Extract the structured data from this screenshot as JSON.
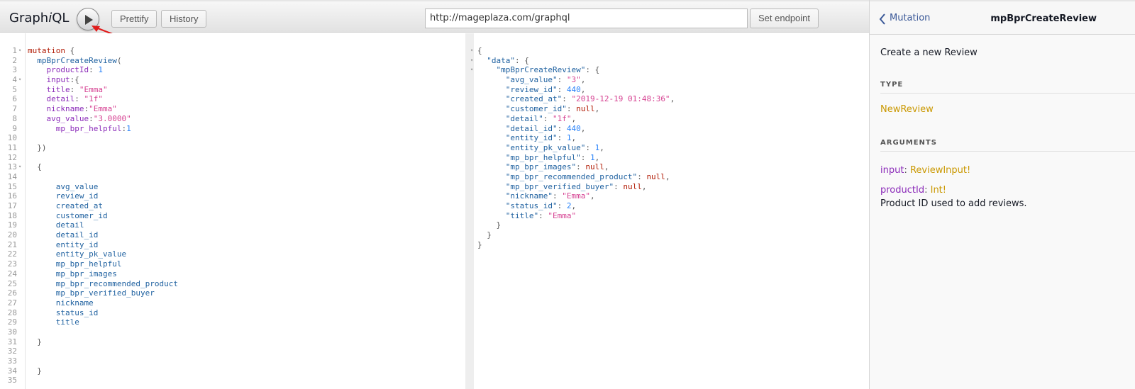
{
  "toolbar": {
    "title_pre": "Graph",
    "title_i": "i",
    "title_post": "QL",
    "prettify_label": "Prettify",
    "history_label": "History",
    "endpoint_url": "http://mageplaza.com/graphql",
    "set_endpoint_label": "Set endpoint"
  },
  "query_lines": [
    {
      "n": "1",
      "fold": true,
      "t": [
        [
          "k",
          "mutation"
        ],
        [
          "p",
          " {"
        ]
      ]
    },
    {
      "n": "2",
      "t": [
        [
          "p",
          "  "
        ],
        [
          "d",
          "mpBprCreateReview"
        ],
        [
          "p",
          "("
        ]
      ]
    },
    {
      "n": "3",
      "t": [
        [
          "p",
          "    "
        ],
        [
          "a",
          "productId"
        ],
        [
          "p",
          ": "
        ],
        [
          "n",
          "1"
        ]
      ]
    },
    {
      "n": "4",
      "fold": true,
      "t": [
        [
          "p",
          "    "
        ],
        [
          "a",
          "input"
        ],
        [
          "p",
          ":{"
        ]
      ]
    },
    {
      "n": "5",
      "t": [
        [
          "p",
          "    "
        ],
        [
          "a",
          "title"
        ],
        [
          "p",
          ": "
        ],
        [
          "s",
          "\"Emma\""
        ]
      ]
    },
    {
      "n": "6",
      "t": [
        [
          "p",
          "    "
        ],
        [
          "a",
          "detail"
        ],
        [
          "p",
          ": "
        ],
        [
          "s",
          "\"1f\""
        ]
      ]
    },
    {
      "n": "7",
      "t": [
        [
          "p",
          "    "
        ],
        [
          "a",
          "nickname"
        ],
        [
          "p",
          ":"
        ],
        [
          "s",
          "\"Emma\""
        ]
      ]
    },
    {
      "n": "8",
      "t": [
        [
          "p",
          "    "
        ],
        [
          "a",
          "avg_value"
        ],
        [
          "p",
          ":"
        ],
        [
          "s",
          "\"3.0000\""
        ]
      ]
    },
    {
      "n": "9",
      "t": [
        [
          "p",
          "      "
        ],
        [
          "a",
          "mp_bpr_helpful"
        ],
        [
          "p",
          ":"
        ],
        [
          "n",
          "1"
        ]
      ]
    },
    {
      "n": "10",
      "t": []
    },
    {
      "n": "11",
      "t": [
        [
          "p",
          "  })"
        ]
      ]
    },
    {
      "n": "12",
      "t": []
    },
    {
      "n": "13",
      "fold": true,
      "t": [
        [
          "p",
          "  {"
        ]
      ]
    },
    {
      "n": "14",
      "t": []
    },
    {
      "n": "15",
      "t": [
        [
          "p",
          "      "
        ],
        [
          "prop",
          "avg_value"
        ]
      ]
    },
    {
      "n": "16",
      "t": [
        [
          "p",
          "      "
        ],
        [
          "prop",
          "review_id"
        ]
      ]
    },
    {
      "n": "17",
      "t": [
        [
          "p",
          "      "
        ],
        [
          "prop",
          "created_at"
        ]
      ]
    },
    {
      "n": "18",
      "t": [
        [
          "p",
          "      "
        ],
        [
          "prop",
          "customer_id"
        ]
      ]
    },
    {
      "n": "19",
      "t": [
        [
          "p",
          "      "
        ],
        [
          "prop",
          "detail"
        ]
      ]
    },
    {
      "n": "20",
      "t": [
        [
          "p",
          "      "
        ],
        [
          "prop",
          "detail_id"
        ]
      ]
    },
    {
      "n": "21",
      "t": [
        [
          "p",
          "      "
        ],
        [
          "prop",
          "entity_id"
        ]
      ]
    },
    {
      "n": "22",
      "t": [
        [
          "p",
          "      "
        ],
        [
          "prop",
          "entity_pk_value"
        ]
      ]
    },
    {
      "n": "23",
      "t": [
        [
          "p",
          "      "
        ],
        [
          "prop",
          "mp_bpr_helpful"
        ]
      ]
    },
    {
      "n": "24",
      "t": [
        [
          "p",
          "      "
        ],
        [
          "prop",
          "mp_bpr_images"
        ]
      ]
    },
    {
      "n": "25",
      "t": [
        [
          "p",
          "      "
        ],
        [
          "prop",
          "mp_bpr_recommended_product"
        ]
      ]
    },
    {
      "n": "26",
      "t": [
        [
          "p",
          "      "
        ],
        [
          "prop",
          "mp_bpr_verified_buyer"
        ]
      ]
    },
    {
      "n": "27",
      "t": [
        [
          "p",
          "      "
        ],
        [
          "prop",
          "nickname"
        ]
      ]
    },
    {
      "n": "28",
      "t": [
        [
          "p",
          "      "
        ],
        [
          "prop",
          "status_id"
        ]
      ]
    },
    {
      "n": "29",
      "t": [
        [
          "p",
          "      "
        ],
        [
          "prop",
          "title"
        ]
      ]
    },
    {
      "n": "30",
      "t": []
    },
    {
      "n": "31",
      "t": [
        [
          "p",
          "  }"
        ]
      ]
    },
    {
      "n": "32",
      "t": []
    },
    {
      "n": "33",
      "t": []
    },
    {
      "n": "34",
      "t": [
        [
          "p",
          "  }"
        ]
      ]
    },
    {
      "n": "35",
      "t": []
    }
  ],
  "result_lines": [
    {
      "fold": true,
      "t": [
        [
          "p",
          "{"
        ]
      ]
    },
    {
      "fold": true,
      "t": [
        [
          "p",
          "  "
        ],
        [
          "d",
          "\"data\""
        ],
        [
          "p",
          ": {"
        ]
      ]
    },
    {
      "fold": true,
      "t": [
        [
          "p",
          "    "
        ],
        [
          "d",
          "\"mpBprCreateReview\""
        ],
        [
          "p",
          ": {"
        ]
      ]
    },
    {
      "t": [
        [
          "p",
          "      "
        ],
        [
          "d",
          "\"avg_value\""
        ],
        [
          "p",
          ": "
        ],
        [
          "s",
          "\"3\""
        ],
        [
          "p",
          ","
        ]
      ]
    },
    {
      "t": [
        [
          "p",
          "      "
        ],
        [
          "d",
          "\"review_id\""
        ],
        [
          "p",
          ": "
        ],
        [
          "n",
          "440"
        ],
        [
          "p",
          ","
        ]
      ]
    },
    {
      "t": [
        [
          "p",
          "      "
        ],
        [
          "d",
          "\"created_at\""
        ],
        [
          "p",
          ": "
        ],
        [
          "s",
          "\"2019-12-19 01:48:36\""
        ],
        [
          "p",
          ","
        ]
      ]
    },
    {
      "t": [
        [
          "p",
          "      "
        ],
        [
          "d",
          "\"customer_id\""
        ],
        [
          "p",
          ": "
        ],
        [
          "nul",
          "null"
        ],
        [
          "p",
          ","
        ]
      ]
    },
    {
      "t": [
        [
          "p",
          "      "
        ],
        [
          "d",
          "\"detail\""
        ],
        [
          "p",
          ": "
        ],
        [
          "s",
          "\"1f\""
        ],
        [
          "p",
          ","
        ]
      ]
    },
    {
      "t": [
        [
          "p",
          "      "
        ],
        [
          "d",
          "\"detail_id\""
        ],
        [
          "p",
          ": "
        ],
        [
          "n",
          "440"
        ],
        [
          "p",
          ","
        ]
      ]
    },
    {
      "t": [
        [
          "p",
          "      "
        ],
        [
          "d",
          "\"entity_id\""
        ],
        [
          "p",
          ": "
        ],
        [
          "n",
          "1"
        ],
        [
          "p",
          ","
        ]
      ]
    },
    {
      "t": [
        [
          "p",
          "      "
        ],
        [
          "d",
          "\"entity_pk_value\""
        ],
        [
          "p",
          ": "
        ],
        [
          "n",
          "1"
        ],
        [
          "p",
          ","
        ]
      ]
    },
    {
      "t": [
        [
          "p",
          "      "
        ],
        [
          "d",
          "\"mp_bpr_helpful\""
        ],
        [
          "p",
          ": "
        ],
        [
          "n",
          "1"
        ],
        [
          "p",
          ","
        ]
      ]
    },
    {
      "t": [
        [
          "p",
          "      "
        ],
        [
          "d",
          "\"mp_bpr_images\""
        ],
        [
          "p",
          ": "
        ],
        [
          "nul",
          "null"
        ],
        [
          "p",
          ","
        ]
      ]
    },
    {
      "t": [
        [
          "p",
          "      "
        ],
        [
          "d",
          "\"mp_bpr_recommended_product\""
        ],
        [
          "p",
          ": "
        ],
        [
          "nul",
          "null"
        ],
        [
          "p",
          ","
        ]
      ]
    },
    {
      "t": [
        [
          "p",
          "      "
        ],
        [
          "d",
          "\"mp_bpr_verified_buyer\""
        ],
        [
          "p",
          ": "
        ],
        [
          "nul",
          "null"
        ],
        [
          "p",
          ","
        ]
      ]
    },
    {
      "t": [
        [
          "p",
          "      "
        ],
        [
          "d",
          "\"nickname\""
        ],
        [
          "p",
          ": "
        ],
        [
          "s",
          "\"Emma\""
        ],
        [
          "p",
          ","
        ]
      ]
    },
    {
      "t": [
        [
          "p",
          "      "
        ],
        [
          "d",
          "\"status_id\""
        ],
        [
          "p",
          ": "
        ],
        [
          "n",
          "2"
        ],
        [
          "p",
          ","
        ]
      ]
    },
    {
      "t": [
        [
          "p",
          "      "
        ],
        [
          "d",
          "\"title\""
        ],
        [
          "p",
          ": "
        ],
        [
          "s",
          "\"Emma\""
        ]
      ]
    },
    {
      "t": [
        [
          "p",
          "    }"
        ]
      ]
    },
    {
      "t": [
        [
          "p",
          "  }"
        ]
      ]
    },
    {
      "t": [
        [
          "p",
          "}"
        ]
      ]
    }
  ],
  "docs": {
    "back_label": "Mutation",
    "title": "mpBprCreateReview",
    "description": "Create a new Review",
    "type_heading": "TYPE",
    "type_name": "NewReview",
    "arguments_heading": "ARGUMENTS",
    "args": [
      {
        "name": "input",
        "type": "ReviewInput!"
      },
      {
        "name": "productId",
        "type": "Int!"
      }
    ],
    "arg2_description": "Product ID used to add reviews."
  },
  "icons": {
    "run": "play-icon",
    "back": "chevron-left-icon",
    "annotation": "red-arrow-annotation"
  },
  "colors": {
    "keyword": "#b11a04",
    "definition": "#1f61a0",
    "attribute": "#8b2bb9",
    "string": "#d64292",
    "number": "#2882f9",
    "type": "#ca9800",
    "annotation_arrow": "#e01b1b"
  }
}
